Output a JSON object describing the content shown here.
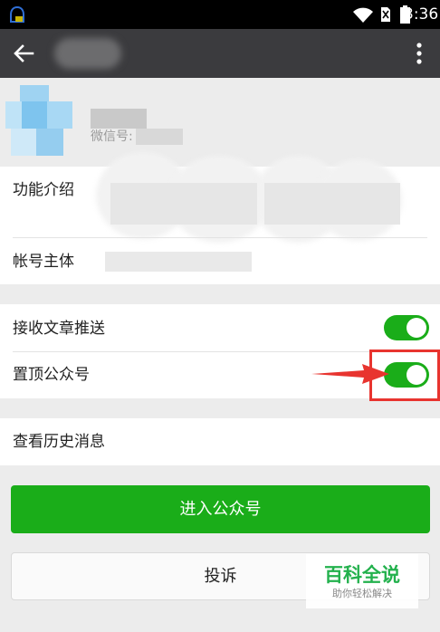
{
  "status_bar": {
    "time": "3:36",
    "icons": [
      "notification-icon",
      "wifi-icon",
      "no-sim-icon",
      "battery-icon"
    ]
  },
  "app_bar": {
    "icons": [
      "back-arrow-icon",
      "more-vert-icon"
    ]
  },
  "profile": {
    "wechat_id_label": "微信号:"
  },
  "info_section": {
    "function_intro_label": "功能介绍",
    "account_owner_label": "帐号主体"
  },
  "settings": {
    "receive_articles_label": "接收文章推送",
    "receive_articles_on": true,
    "pin_account_label": "置顶公众号",
    "pin_account_on": true
  },
  "history": {
    "label": "查看历史消息"
  },
  "buttons": {
    "enter_account": "进入公众号",
    "report": "投诉"
  },
  "watermark": {
    "title": "百科全说",
    "subtitle": "助你轻松解决"
  },
  "colors": {
    "accent_green": "#1aad19",
    "app_bar": "#3b3b3e",
    "annotation_red": "#e8342f",
    "watermark_green": "#23b14d"
  }
}
